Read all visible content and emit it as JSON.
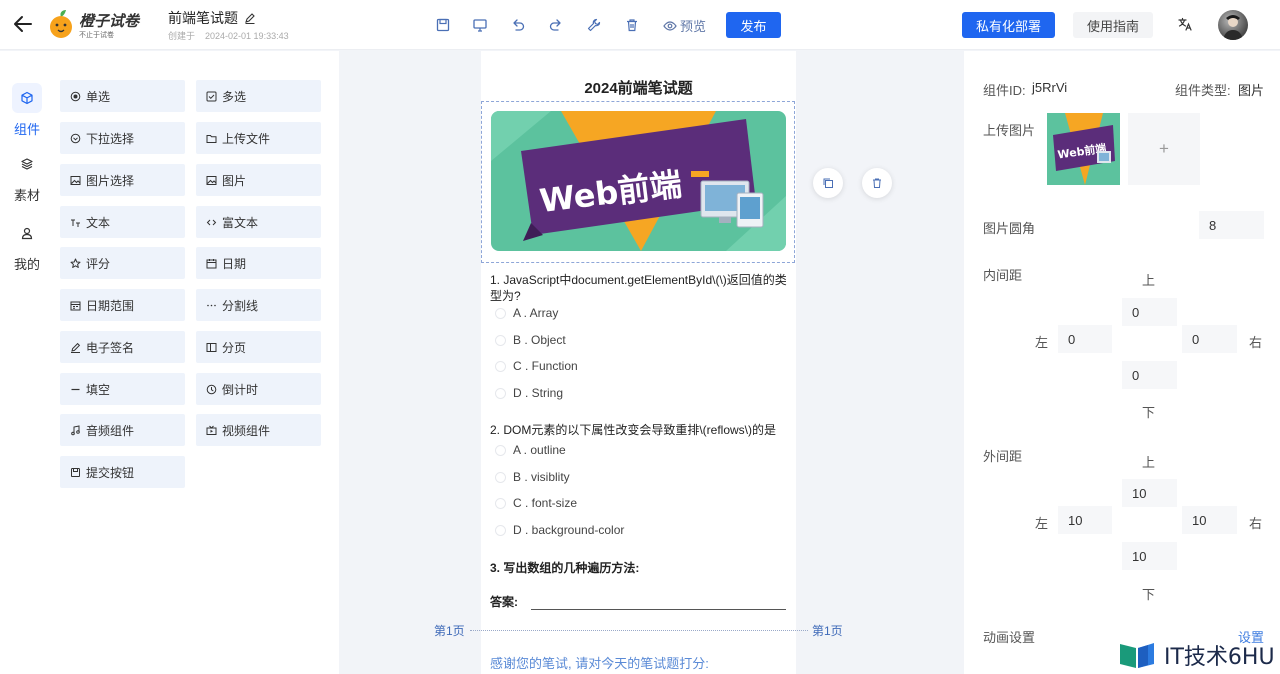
{
  "header": {
    "logo_title": "橙子试卷",
    "logo_subtitle": "不止于试卷",
    "doc_title": "前端笔试题",
    "created_label": "创建于",
    "created_time": "2024-02-01 19:33:43",
    "preview_label": "预览",
    "publish_label": "发布",
    "deploy_label": "私有化部署",
    "guide_label": "使用指南"
  },
  "rail": [
    {
      "label": "组件",
      "icon": "cube-icon",
      "active": true
    },
    {
      "label": "素材",
      "icon": "layers-icon",
      "active": false
    },
    {
      "label": "我的",
      "icon": "user-icon",
      "active": false
    }
  ],
  "components": [
    {
      "label": "单选",
      "icon": "radio-icon"
    },
    {
      "label": "多选",
      "icon": "checkbox-icon"
    },
    {
      "label": "下拉选择",
      "icon": "dropdown-icon"
    },
    {
      "label": "上传文件",
      "icon": "folder-icon"
    },
    {
      "label": "图片选择",
      "icon": "image-select-icon"
    },
    {
      "label": "图片",
      "icon": "image-icon"
    },
    {
      "label": "文本",
      "icon": "text-icon"
    },
    {
      "label": "富文本",
      "icon": "code-icon"
    },
    {
      "label": "评分",
      "icon": "star-icon"
    },
    {
      "label": "日期",
      "icon": "calendar-icon"
    },
    {
      "label": "日期范围",
      "icon": "date-range-icon"
    },
    {
      "label": "分割线",
      "icon": "divider-icon"
    },
    {
      "label": "电子签名",
      "icon": "pen-icon"
    },
    {
      "label": "分页",
      "icon": "pagination-icon"
    },
    {
      "label": "填空",
      "icon": "blank-icon"
    },
    {
      "label": "倒计时",
      "icon": "countdown-icon"
    },
    {
      "label": "音频组件",
      "icon": "music-icon"
    },
    {
      "label": "视频组件",
      "icon": "video-icon"
    },
    {
      "label": "提交按钮",
      "icon": "save-icon"
    }
  ],
  "paper": {
    "title": "2024前端笔试题",
    "banner_text": "Web前端",
    "questions": [
      {
        "title": "1. JavaScript中document.getElementById\\(\\)返回值的类型为?",
        "options": [
          "A . Array",
          "B . Object",
          "C . Function",
          "D . String"
        ]
      },
      {
        "title": "2. DOM元素的以下属性改变会导致重排\\(reflows\\)的是",
        "options": [
          "A . outline",
          "B . visiblity",
          "C . font-size",
          "D . background-color"
        ]
      }
    ],
    "q3_title": "3. 写出数组的几种遍历方法:",
    "answer_label": "答案:",
    "page_label": "第1页",
    "thanks_text": "感谢您的笔试, 请对今天的笔试题打分:"
  },
  "panel": {
    "component_id_label": "组件ID:",
    "component_id": "j5RrVi",
    "component_type_label": "组件类型:",
    "component_type": "图片",
    "upload_label": "上传图片",
    "upload_plus": "+",
    "radius_label": "图片圆角",
    "radius_value": "8",
    "padding_label": "内间距",
    "padding": {
      "top": "0",
      "left": "0",
      "right": "0",
      "bottom": "0"
    },
    "margin_label": "外间距",
    "margin": {
      "top": "10",
      "left": "10",
      "right": "10",
      "bottom": "10"
    },
    "dir_top": "上",
    "dir_bottom": "下",
    "dir_left": "左",
    "dir_right": "右",
    "animation_label": "动画设置",
    "animation_link": "设置"
  },
  "watermark": "IT技术6HU",
  "colors": {
    "primary": "#1f66f0",
    "accent_link": "#3f7de0",
    "banner_green": "#5fc3a0",
    "banner_purple": "#5b2d7a",
    "banner_orange": "#f6a623"
  }
}
